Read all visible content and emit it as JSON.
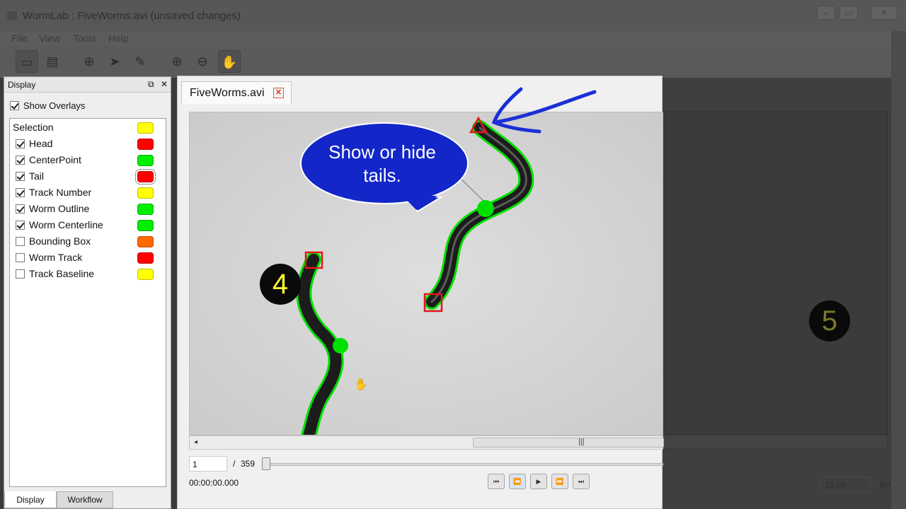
{
  "window": {
    "title": "WormLab : FiveWorms.avi (unsaved changes)"
  },
  "menu": [
    "File",
    "View",
    "Tools",
    "Help"
  ],
  "toolbar": {
    "tools": [
      "display-mode",
      "layout-mode",
      "crosshair",
      "select",
      "draw",
      "zoom-in",
      "zoom-out",
      "pan"
    ]
  },
  "dock": {
    "title": "Display",
    "show_overlays": {
      "label": "Show Overlays",
      "checked": true
    },
    "section_label": "Selection",
    "section_color": "#ffff00",
    "items": [
      {
        "label": "Head",
        "checked": true,
        "color": "#ff0000"
      },
      {
        "label": "CenterPoint",
        "checked": true,
        "color": "#00ee00"
      },
      {
        "label": "Tail",
        "checked": true,
        "color": "#ff0000"
      },
      {
        "label": "Track Number",
        "checked": true,
        "color": "#ffff00"
      },
      {
        "label": "Worm Outline",
        "checked": true,
        "color": "#00ee00"
      },
      {
        "label": "Worm Centerline",
        "checked": true,
        "color": "#00ee00"
      },
      {
        "label": "Bounding Box",
        "checked": false,
        "color": "#ff6a00"
      },
      {
        "label": "Worm Track",
        "checked": false,
        "color": "#ff0000"
      },
      {
        "label": "Track Baseline",
        "checked": false,
        "color": "#ffff00"
      }
    ],
    "tabs": [
      "Display",
      "Workflow"
    ]
  },
  "document": {
    "tab_label": "FiveWorms.avi",
    "frame_current": "1",
    "frame_separator": "/",
    "frame_total": "359",
    "timecode": "00:00:00.000",
    "fps_value": "25.00",
    "fps_label": "fps"
  },
  "annotation": {
    "bubble_text_line1": "Show or hide",
    "bubble_text_line2": "tails.",
    "track_numbers": [
      "4",
      "5"
    ]
  },
  "colors": {
    "outline": "#00ee00",
    "head_tail": "#ee1111",
    "arrow": "#1a2fd6",
    "bubble": "#1326c8"
  }
}
